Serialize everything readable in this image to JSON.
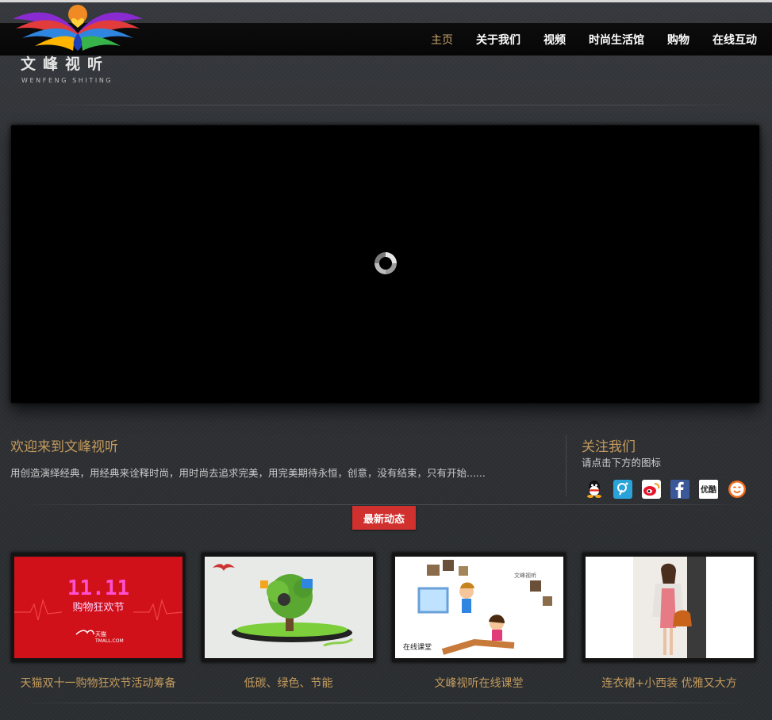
{
  "brand": {
    "name_cn": "文峰视听",
    "name_en": "WENFENG SHITING"
  },
  "nav": {
    "items": [
      {
        "label": "主页",
        "active": true
      },
      {
        "label": "关于我们",
        "active": false
      },
      {
        "label": "视频",
        "active": false
      },
      {
        "label": "时尚生活馆",
        "active": false
      },
      {
        "label": "购物",
        "active": false
      },
      {
        "label": "在线互动",
        "active": false
      }
    ]
  },
  "welcome": {
    "title": "欢迎来到文峰视听",
    "text": "用创造演绎经典，用经典来诠释时尚，用时尚去追求完美，用完美期待永恒，创意，没有结束，只有开始......"
  },
  "follow": {
    "title": "关注我们",
    "subtitle": "请点击下方的图标",
    "icons": [
      "qq-icon",
      "tencent-weibo-icon",
      "sina-weibo-icon",
      "facebook-icon",
      "youku-icon",
      "smiley-icon"
    ],
    "youku_text": "优酷"
  },
  "news_button": "最新动态",
  "cards": [
    {
      "label": "天猫双十一购物狂欢节活动筹备",
      "img_text_1": "11.11",
      "img_text_2": "购物狂欢节",
      "img_text_3": "天猫",
      "img_text_4": "TMALL.COM"
    },
    {
      "label": "低碳、绿色、节能"
    },
    {
      "label": "文峰视听在线课堂",
      "img_text_1": "在线课堂"
    },
    {
      "label": "连衣裙+小西装 优雅又大方"
    }
  ],
  "colors": {
    "accent": "#c39a5d",
    "button": "#d0302e",
    "background": "#2f3236"
  }
}
